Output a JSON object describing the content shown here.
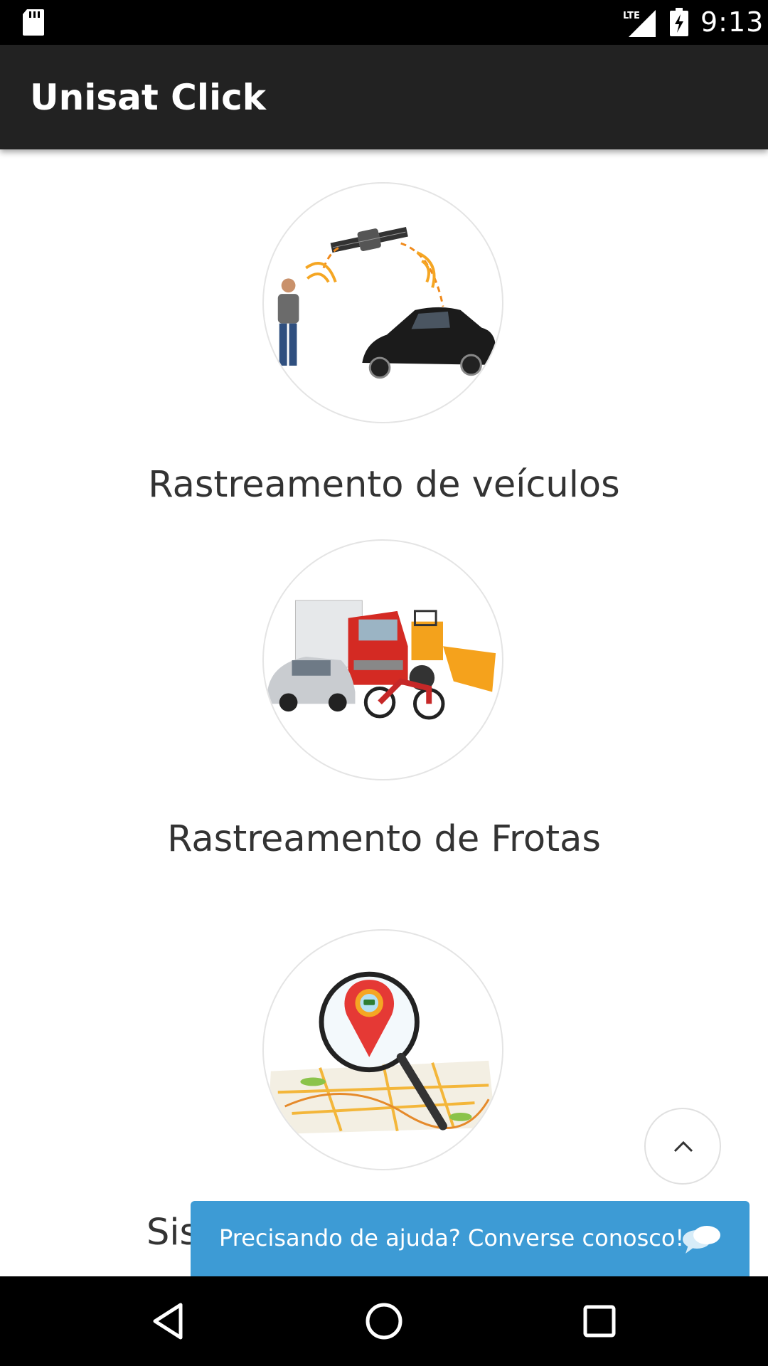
{
  "status_bar": {
    "network": "LTE",
    "time": "9:13"
  },
  "app_bar": {
    "title": "Unisat Click"
  },
  "services": [
    {
      "title": "Rastreamento de veículos",
      "image": "vehicle-tracking-illustration"
    },
    {
      "title": "Rastreamento de Frotas",
      "image": "fleet-tracking-illustration"
    },
    {
      "title": "Sis",
      "image": "map-search-illustration"
    }
  ],
  "chat": {
    "text": "Precisando de ajuda? Converse conosco!",
    "icon": "chat-bubbles-icon"
  },
  "scroll_top": {
    "icon": "chevron-up-icon"
  },
  "nav_bar": {
    "back_icon": "back-triangle-icon",
    "home_icon": "home-circle-icon",
    "recents_icon": "recents-square-icon"
  },
  "colors": {
    "app_bar": "#222222",
    "chat_banner": "#3d9bd5",
    "text": "#333333"
  }
}
